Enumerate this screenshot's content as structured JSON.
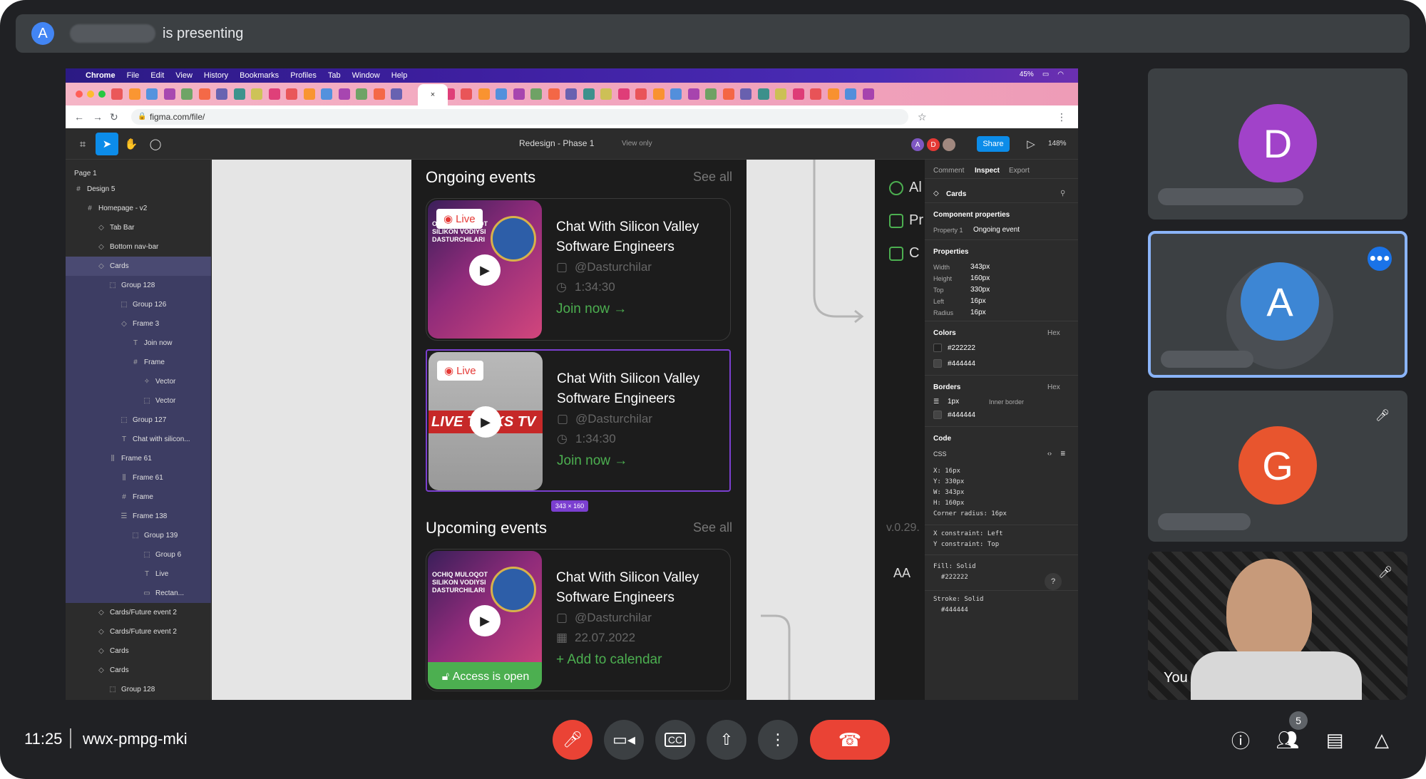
{
  "presenter": {
    "avatar_letter": "A",
    "text": "is presenting"
  },
  "mac_menu": {
    "items": [
      "Chrome",
      "File",
      "Edit",
      "View",
      "History",
      "Bookmarks",
      "Profiles",
      "Tab",
      "Window",
      "Help"
    ],
    "battery": "45%"
  },
  "browser": {
    "url": "figma.com/file/",
    "active_tab_close": "×"
  },
  "figma": {
    "file_title": "Redesign - Phase 1",
    "view_only": "View only",
    "share_label": "Share",
    "zoom": "148%",
    "collaborators": [
      "A",
      "D"
    ],
    "page_label": "Page 1",
    "layers": [
      {
        "label": "Design 5",
        "indent": 1,
        "glyph": "#"
      },
      {
        "label": "Homepage - v2",
        "indent": 2,
        "glyph": "#"
      },
      {
        "label": "Tab Bar",
        "indent": 3,
        "glyph": "◇"
      },
      {
        "label": "Bottom nav-bar",
        "indent": 3,
        "glyph": "◇"
      },
      {
        "label": "Cards",
        "indent": 3,
        "glyph": "◇",
        "state": "selected"
      },
      {
        "label": "Group 128",
        "indent": 4,
        "glyph": "⬚",
        "state": "child"
      },
      {
        "label": "Group 126",
        "indent": 5,
        "glyph": "⬚",
        "state": "child"
      },
      {
        "label": "Frame 3",
        "indent": 5,
        "glyph": "◇",
        "state": "child"
      },
      {
        "label": "Join now",
        "indent": 6,
        "glyph": "T",
        "state": "child"
      },
      {
        "label": "Frame",
        "indent": 6,
        "glyph": "#",
        "state": "child"
      },
      {
        "label": "Vector",
        "indent": 7,
        "glyph": "✧",
        "state": "child"
      },
      {
        "label": "Vector",
        "indent": 7,
        "glyph": "⬚",
        "state": "child"
      },
      {
        "label": "Group 127",
        "indent": 5,
        "glyph": "⬚",
        "state": "child"
      },
      {
        "label": "Chat with silicon...",
        "indent": 5,
        "glyph": "T",
        "state": "child"
      },
      {
        "label": "Frame 61",
        "indent": 4,
        "glyph": "⫼",
        "state": "child"
      },
      {
        "label": "Frame 61",
        "indent": 5,
        "glyph": "⫼",
        "state": "child"
      },
      {
        "label": "Frame",
        "indent": 5,
        "glyph": "#",
        "state": "child"
      },
      {
        "label": "Frame 138",
        "indent": 5,
        "glyph": "☰",
        "state": "child"
      },
      {
        "label": "Group 139",
        "indent": 6,
        "glyph": "⬚",
        "state": "child"
      },
      {
        "label": "Group 6",
        "indent": 7,
        "glyph": "⬚",
        "state": "child"
      },
      {
        "label": "Live",
        "indent": 7,
        "glyph": "T",
        "state": "child"
      },
      {
        "label": "Rectan...",
        "indent": 7,
        "glyph": "▭",
        "state": "child"
      },
      {
        "label": "Cards/Future event 2",
        "indent": 3,
        "glyph": "◇"
      },
      {
        "label": "Cards/Future event 2",
        "indent": 3,
        "glyph": "◇"
      },
      {
        "label": "Cards",
        "indent": 3,
        "glyph": "◇"
      },
      {
        "label": "Cards",
        "indent": 3,
        "glyph": "◇"
      },
      {
        "label": "Group 128",
        "indent": 4,
        "glyph": "⬚"
      }
    ]
  },
  "canvas": {
    "ongoing_title": "Ongoing events",
    "upcoming_title": "Upcoming events",
    "see_all": "See all",
    "selection_size": "343 × 160",
    "cards": [
      {
        "title": "Chat With Silicon Valley Software Engineers",
        "live": "Live",
        "handle": "@Dasturchilar",
        "meta2": "1:34:30",
        "action": "Join now",
        "thumb": "pink"
      },
      {
        "title": "Chat With Silicon Valley Software Engineers",
        "live": "Live",
        "handle": "@Dasturchilar",
        "meta2": "1:34:30",
        "action": "Join now",
        "thumb": "gray",
        "band": "LIVE TALKS TV"
      },
      {
        "title": "Chat With Silicon Valley Software Engineers",
        "handle": "@Dasturchilar",
        "meta2": "22.07.2022",
        "action": "Add to calendar",
        "thumb": "pink",
        "access": "Access is open"
      }
    ],
    "thumb_text": "OCHIQ MULOQOT SILIKON VODIYSI DASTURCHILARI",
    "side_labels": [
      "Al",
      "Pr",
      "C"
    ],
    "version": "v.0.29.",
    "aa": "AA"
  },
  "inspect": {
    "tabs": [
      "Comment",
      "Inspect",
      "Export"
    ],
    "component": "Cards",
    "component_props_title": "Component properties",
    "prop_key": "Property 1",
    "prop_val": "Ongoing event",
    "properties_title": "Properties",
    "properties": [
      {
        "k": "Width",
        "v": "343px"
      },
      {
        "k": "Height",
        "v": "160px"
      },
      {
        "k": "Top",
        "v": "330px"
      },
      {
        "k": "Left",
        "v": "16px"
      },
      {
        "k": "Radius",
        "v": "16px"
      }
    ],
    "colors_title": "Colors",
    "hex_label": "Hex",
    "colors": [
      "#222222",
      "#444444"
    ],
    "borders_title": "Borders",
    "border_width": "1px",
    "border_type": "Inner border",
    "border_color": "#444444",
    "code_title": "Code",
    "code_lang": "CSS",
    "code_1": "X: 16px\nY: 330px\nW: 343px\nH: 160px\nCorner radius: 16px",
    "code_2": "X constraint: Left\nY constraint: Top",
    "code_3": "Fill: Solid\n  #222222",
    "code_4": "Stroke: Solid\n  #444444"
  },
  "participants": [
    {
      "letter": "D",
      "color": "#a142c9"
    },
    {
      "letter": "A",
      "color": "#3d86d4"
    },
    {
      "letter": "G",
      "color": "#e8552e"
    },
    {
      "label": "You"
    }
  ],
  "meeting": {
    "time": "11:25",
    "code": "wwx-pmpg-mki",
    "people_count": "5"
  }
}
